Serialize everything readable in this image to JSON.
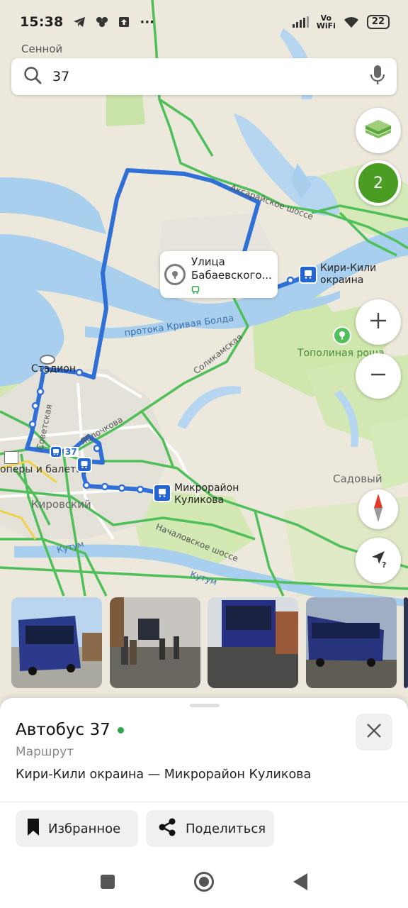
{
  "status_bar": {
    "time": "15:38",
    "network_label_top": "Vo",
    "network_label_bottom": "WiFi",
    "battery": "22",
    "more": "···"
  },
  "search": {
    "query": "37",
    "icon": "search-icon",
    "mic_icon": "microphone-icon"
  },
  "map": {
    "labels": {
      "sennoy": "Сенной",
      "akseray_road": "Аксарайское шоссе",
      "krivaya_bolda": "протока Кривая Болда",
      "solikamskaya": "Соликамская",
      "stadium": "Стадион",
      "yablochkova": "Яблочкова",
      "sovetskaya": "Советская",
      "opera": "оперы и балета",
      "kirovsky": "Кировский",
      "sadovy": "Садовый",
      "nachalovskoe": "Началовское шоссе",
      "kutum_1": "Кутум",
      "kutum_2": "Кутум",
      "topolinaya": "Тополиная роща",
      "route_badge": "37"
    },
    "callout": {
      "title": "Улица Бабаевского..."
    },
    "stops": {
      "start_line1": "Кири-Кили",
      "start_line2": "окраина",
      "end_line1": "Микрорайон",
      "end_line2": "Куликова"
    },
    "layers_count": "2",
    "route_color": "#2f6fd6",
    "accent_green": "#4a9d23"
  },
  "sheet": {
    "title": "Автобус 37",
    "subtitle": "Маршрут",
    "route": "Кири-Кили окраина — Микрорайон Куликова",
    "favorite": "Избранное",
    "share": "Поделиться"
  }
}
